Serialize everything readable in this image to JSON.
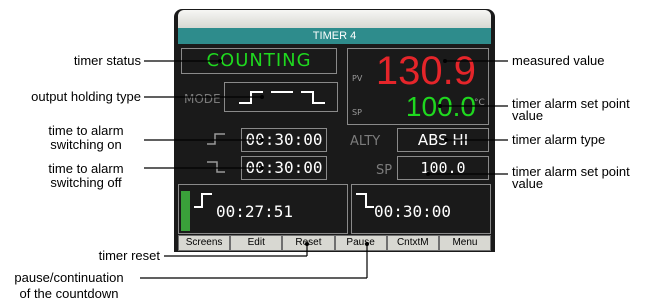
{
  "window": {
    "title": "TIMER 4"
  },
  "device": {
    "status": "COUNTING",
    "mode_label": "MODE",
    "pv_label": "PV",
    "sp_label": "SP",
    "measured_value": "130.9",
    "alarm_setpoint_value": "100.0",
    "unit": "°C",
    "time_on": "00:30:00",
    "time_off": "00:30:00",
    "alty_label": "ALTY",
    "alarm_type": "ABS HI",
    "sp2_label": "SP",
    "alarm_sp_value": "100.0",
    "countdown_on": "00:27:51",
    "countdown_off": "00:30:00",
    "progress_fraction": 0.07
  },
  "softkeys": [
    "Screens",
    "Edit",
    "Reset",
    "Pause",
    "CntxtM",
    "Menu"
  ],
  "annotations": {
    "timer_status": "timer status",
    "output_holding_type": "output holding type",
    "time_on_1": "time to alarm",
    "time_on_2": "switching on",
    "time_off_1": "time to alarm",
    "time_off_2": "switching off",
    "timer_reset": "timer reset",
    "pause_1": "pause/continuation",
    "pause_2": "of the countdown",
    "measured_value": "measured value",
    "alarm_sp_1a": "timer alarm set point",
    "alarm_sp_1b": "value",
    "alarm_type": "timer alarm type",
    "alarm_sp_2a": "timer alarm set point",
    "alarm_sp_2b": "value"
  },
  "colors": {
    "title_bar": "#2e8c8c",
    "status_green": "#1fd81f",
    "pv_red": "#e5252a",
    "progress_green": "#3aa03a",
    "device_bg": "#1a1a1a"
  }
}
